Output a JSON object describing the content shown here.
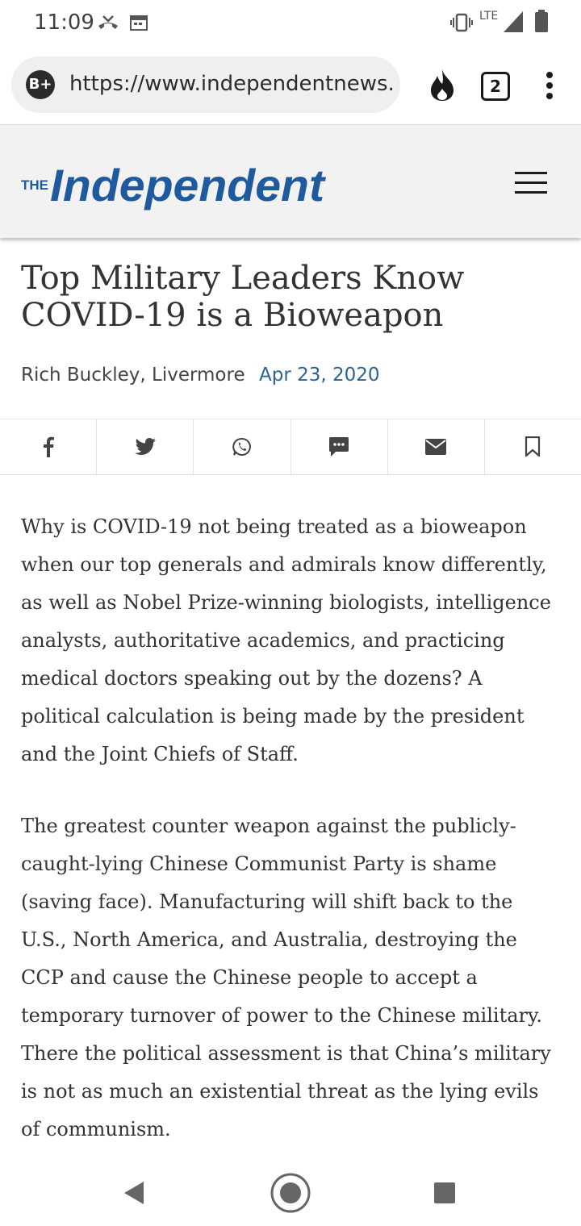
{
  "status_bar": {
    "time": "11:09",
    "network_label": "LTE",
    "icons": [
      "missed-call-icon",
      "calendar-icon",
      "vibrate-icon",
      "signal-icon",
      "battery-icon"
    ]
  },
  "browser": {
    "badge": "B+",
    "url": "https://www.independentnews.",
    "tab_count": "2",
    "icons": [
      "fire-icon",
      "tabs-icon",
      "more-vert-icon"
    ]
  },
  "site": {
    "logo_prefix": "THE",
    "logo_name": "Independent",
    "brand_color": "#1f5a9e"
  },
  "article": {
    "headline": "Top Military Leaders Know COVID-19 is a Bioweapon",
    "author": "Rich Buckley, Livermore",
    "date": "Apr 23, 2020",
    "share_icons": [
      "facebook-icon",
      "twitter-icon",
      "whatsapp-icon",
      "sms-icon",
      "email-icon",
      "bookmark-icon"
    ],
    "paragraphs": [
      "Why is COVID-19 not being treated as a bioweapon when our top generals and admirals know differently, as well as Nobel Prize-winning biologists, intelligence analysts, authoritative academics, and practicing medical doctors speaking out by the dozens? A political calculation is being made by the president and the Joint Chiefs of Staff.",
      "The greatest counter weapon against the publicly-caught-lying Chinese Communist Party is shame (saving face). Manufacturing will shift back to the U.S., North America, and Australia, destroying the CCP and cause the Chinese people to accept a temporary turnover of power to the Chinese military. There the political assessment is that China’s military is not as much an existential threat as the lying evils of communism."
    ]
  },
  "nav_bar": {
    "icons": [
      "back-icon",
      "home-icon",
      "recents-icon"
    ]
  }
}
